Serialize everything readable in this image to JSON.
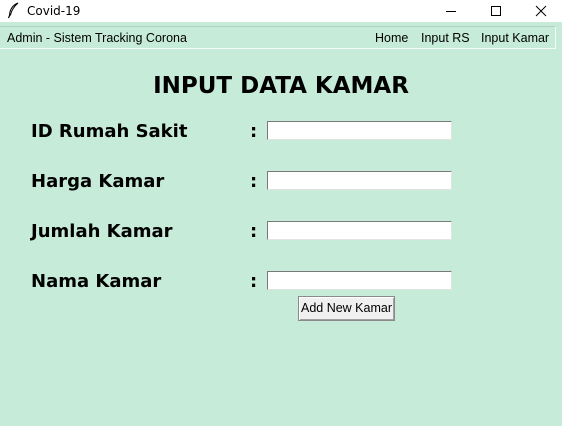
{
  "window": {
    "title": "Covid-19"
  },
  "menubar": {
    "brand": "Admin - Sistem Tracking Corona",
    "items": [
      "Home",
      "Input RS",
      "Input Kamar"
    ]
  },
  "form": {
    "heading": "INPUT DATA KAMAR",
    "separator": ":",
    "fields": [
      {
        "label": "ID Rumah Sakit",
        "value": ""
      },
      {
        "label": "Harga Kamar",
        "value": ""
      },
      {
        "label": "Jumlah Kamar",
        "value": ""
      },
      {
        "label": "Nama Kamar",
        "value": ""
      }
    ],
    "submit_label": "Add New Kamar"
  },
  "colors": {
    "background": "#c6ebd9",
    "titlebar": "#ffffff"
  },
  "icons": {
    "app": "feather-icon",
    "minimize": "minimize-icon",
    "maximize": "maximize-icon",
    "close": "close-icon"
  }
}
